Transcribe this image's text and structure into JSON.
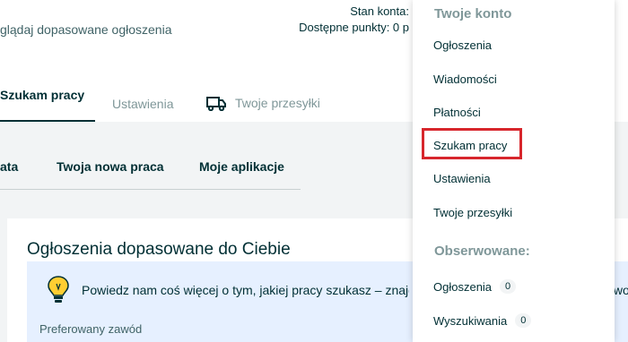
{
  "header": {
    "top_left_text": "glądaj dopasowane ogłoszenia",
    "account_status_label": "Stan konta:",
    "available_points_label": "Dostępne punkty: 0 p"
  },
  "tabs": [
    {
      "label": "Szukam pracy",
      "active": true
    },
    {
      "label": "Ustawienia",
      "active": false
    },
    {
      "label": "Twoje przesyłki",
      "active": false,
      "icon": "truck-icon"
    }
  ],
  "subtabs": [
    "ata",
    "Twoja nowa praca",
    "Moje aplikacje"
  ],
  "card": {
    "title": "Ogłoszenia dopasowane do Ciebie",
    "info_text": "Powiedz nam coś więcej o tym, jakiej pracy szukasz – znajdzi",
    "info_text_tail": "two",
    "preferred_label": "Preferowany zawód",
    "icon": "lightbulb-icon"
  },
  "dropdown": {
    "account_heading": "Twoje konto",
    "account_items": [
      "Ogłoszenia",
      "Wiadomości",
      "Płatności",
      "Szukam pracy",
      "Ustawienia",
      "Twoje przesyłki"
    ],
    "highlighted_item": "Szukam pracy",
    "observed_heading": "Obserwowane:",
    "observed_items": [
      {
        "label": "Ogłoszenia",
        "count": "0"
      },
      {
        "label": "Wyszukiwania",
        "count": "0"
      }
    ]
  },
  "colors": {
    "primary_text": "#002f34",
    "muted_text": "#7f9799",
    "info_background": "#e6f0ff",
    "page_background": "#f2f4f5",
    "highlight_border": "#d7262c",
    "bulb": "#ffce32"
  }
}
